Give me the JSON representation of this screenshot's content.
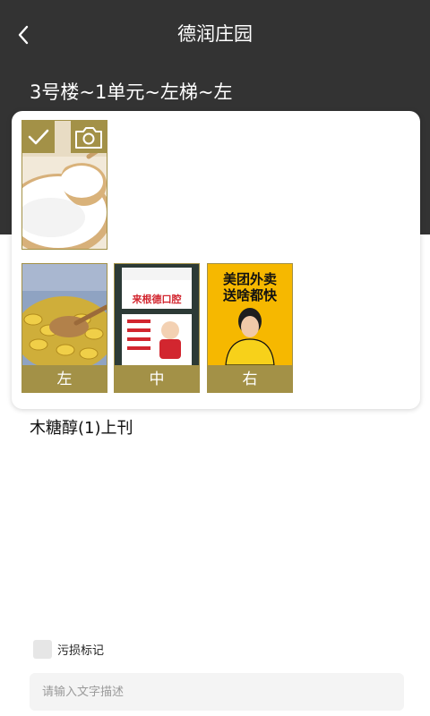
{
  "header": {
    "title": "德润庄园",
    "location": "3号楼~1单元~左梯~左"
  },
  "photos": {
    "main": {
      "icon_check": "check-icon",
      "icon_camera": "camera-icon"
    },
    "positions": [
      {
        "label": "左",
        "promo_text": ""
      },
      {
        "label": "中",
        "promo_text": "来根德口腔"
      },
      {
        "label": "右",
        "promo_text": "美团外卖\n送啥都快"
      }
    ]
  },
  "product": {
    "name": "木糖醇(1)上刊"
  },
  "damage": {
    "label": "污损标记",
    "checked": false
  },
  "description": {
    "placeholder": "请输入文字描述",
    "value": ""
  },
  "colors": {
    "header_bg": "#333333",
    "accent": "#a39147",
    "promo_yellow": "#f6b800"
  }
}
